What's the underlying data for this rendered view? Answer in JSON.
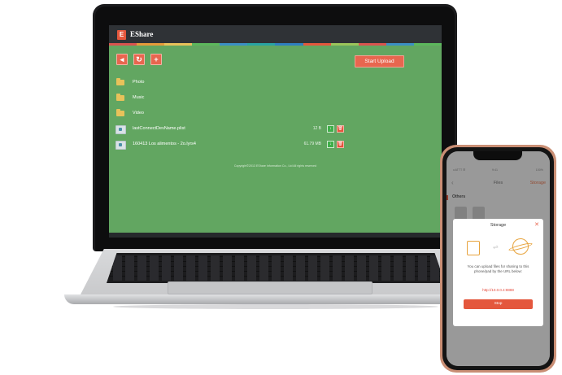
{
  "laptop": {
    "app": {
      "logo_letter": "E",
      "title": "EShare",
      "header_color": "#2f3236",
      "background_color": "#62a661",
      "color_strip": [
        "#d9534f",
        "#e69b3a",
        "#e8c25a",
        "#5cb85c",
        "#3b8fc4",
        "#29a3a3",
        "#2f7fbf",
        "#e4573d",
        "#9bc45a",
        "#d9534f",
        "#3b8fc4",
        "#5cb85c"
      ]
    },
    "toolbar": {
      "back_icon": "back-arrow-icon",
      "refresh_icon": "refresh-icon",
      "add_icon": "plus-icon",
      "back_glyph": "◂",
      "refresh_glyph": "↻",
      "add_glyph": "+",
      "upload_label": "Start Upload"
    },
    "rows": [
      {
        "type": "folder",
        "name": "Photo"
      },
      {
        "type": "folder",
        "name": "Music"
      },
      {
        "type": "folder",
        "name": "Video"
      },
      {
        "type": "file",
        "name": "lastConnectDevName.plist",
        "size": "12 B"
      },
      {
        "type": "file",
        "name": "160413 Los alimentos - 2o.lyrs4",
        "size": "61.79 MB"
      }
    ],
    "download_glyph": "↓",
    "delete_glyph": "🗑",
    "copyright": "Copyright©2013 EShare Information Co., Ltd All rights reserved"
  },
  "phone": {
    "status": {
      "left": "••ATTT ☰",
      "center": "9:41",
      "right": "100%"
    },
    "nav": {
      "back": "‹",
      "title": "Files",
      "storage": "Storage"
    },
    "section": "Others",
    "dialog": {
      "title": "Storage",
      "close": "✕",
      "arrows": "⇌",
      "message": "You can upload files for sharing to this phone/pad by the URL below:",
      "url": "http://10.0.0.4:8888",
      "stop_label": "Stop"
    },
    "accent_color": "#e4573d"
  }
}
